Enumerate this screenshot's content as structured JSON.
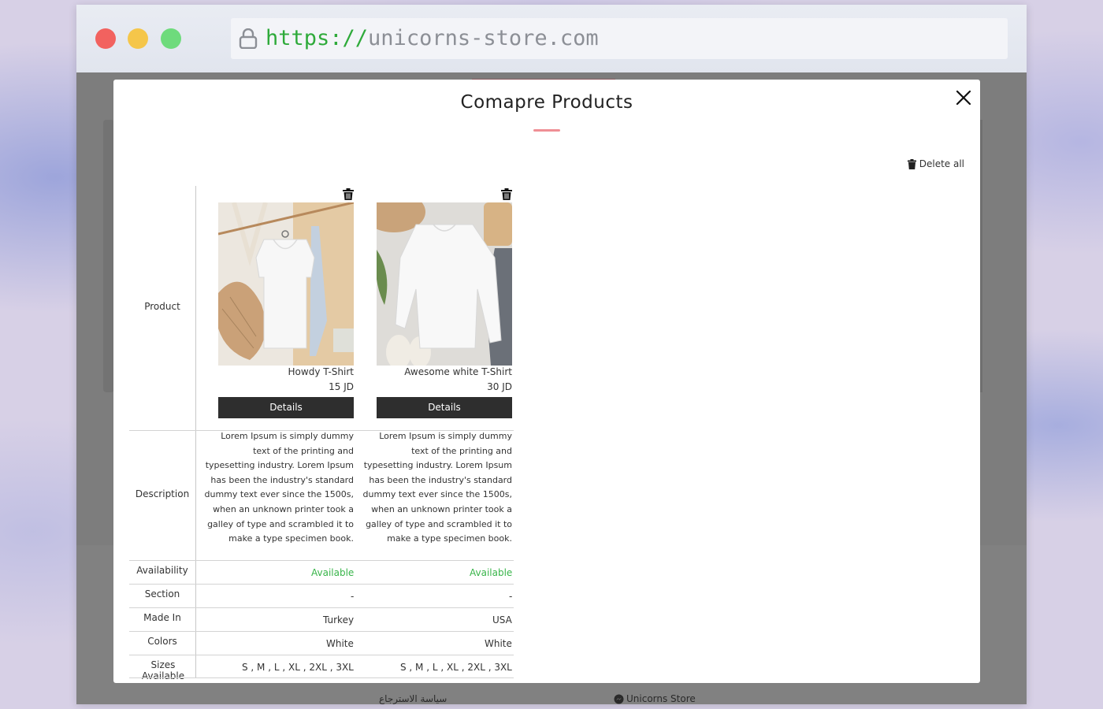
{
  "browser": {
    "url_protocol": "https://",
    "url_host": "unicorns-store.com"
  },
  "background_page": {
    "footer_left_text": "سياسة الاسترجاع",
    "footer_right_text": "Unicorns Store"
  },
  "modal": {
    "title": "Comapre Products",
    "delete_all_label": "Delete all",
    "row_labels": {
      "product": "Product",
      "description": "Description",
      "availability": "Availability",
      "section": "Section",
      "made_in": "Made In",
      "colors": "Colors",
      "sizes": "Sizes Available"
    },
    "products": [
      {
        "name": "Howdy T-Shirt",
        "price": "15 JD",
        "details_label": "Details",
        "description": "Lorem Ipsum is simply dummy text of the printing and typesetting industry. Lorem Ipsum has been the industry's standard dummy text ever since the 1500s, when an unknown printer took a galley of type and scrambled it to make a type specimen book.",
        "availability": "Available",
        "section": "-",
        "made_in": "Turkey",
        "colors": "White",
        "sizes": "S , M , L , XL , 2XL , 3XL"
      },
      {
        "name": "Awesome white T-Shirt",
        "price": "30 JD",
        "details_label": "Details",
        "description": "Lorem Ipsum is simply dummy text of the printing and typesetting industry. Lorem Ipsum has been the industry's standard dummy text ever since the 1500s, when an unknown printer took a galley of type and scrambled it to make a type specimen book.",
        "availability": "Available",
        "section": "-",
        "made_in": "USA",
        "colors": "White",
        "sizes": "S , M , L , XL , 2XL , 3XL"
      }
    ]
  },
  "colors": {
    "available": "#39b54a",
    "accent_underline": "#ef8f95",
    "button_dark": "#2e2e2e"
  }
}
